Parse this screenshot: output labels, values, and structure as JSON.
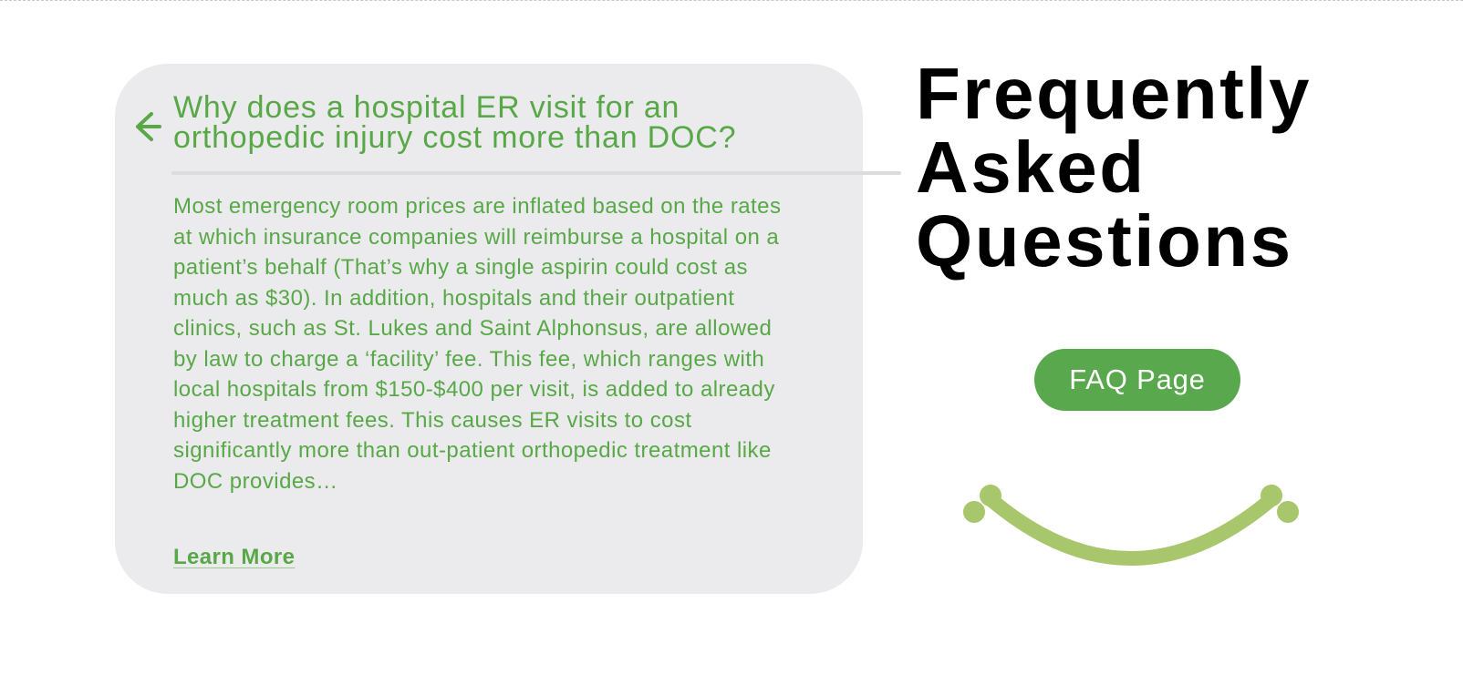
{
  "faq_card": {
    "back_icon": "arrow-left-icon",
    "question": "Why does a hospital ER visit for an orthopedic injury cost more than DOC?",
    "answer": "Most emergency room prices are inflated based on the rates at which insurance companies will reimburse a hospital on a patient’s behalf (That’s why a single aspirin could cost as much as $30). In addition, hospitals and their outpatient clinics, such as St. Lukes and Saint Alphonsus, are allowed by law to charge a ‘facility’ fee. This fee, which ranges with local hospitals from $150-$400 per visit, is added to already higher treatment fees. This causes ER visits to cost significantly more than out-patient orthopedic treatment like DOC provides…",
    "learn_more_label": "Learn More"
  },
  "sidebar": {
    "heading_lines": [
      "Frequently",
      "Asked",
      "Questions"
    ],
    "faq_button_label": "FAQ Page",
    "decoration_icon": "smile-icon"
  },
  "colors": {
    "accent_green": "#58a848",
    "button_green": "#5aa84d",
    "smile_green": "#a8c66c",
    "card_background": "#ebebed",
    "heading_text": "#000000"
  }
}
